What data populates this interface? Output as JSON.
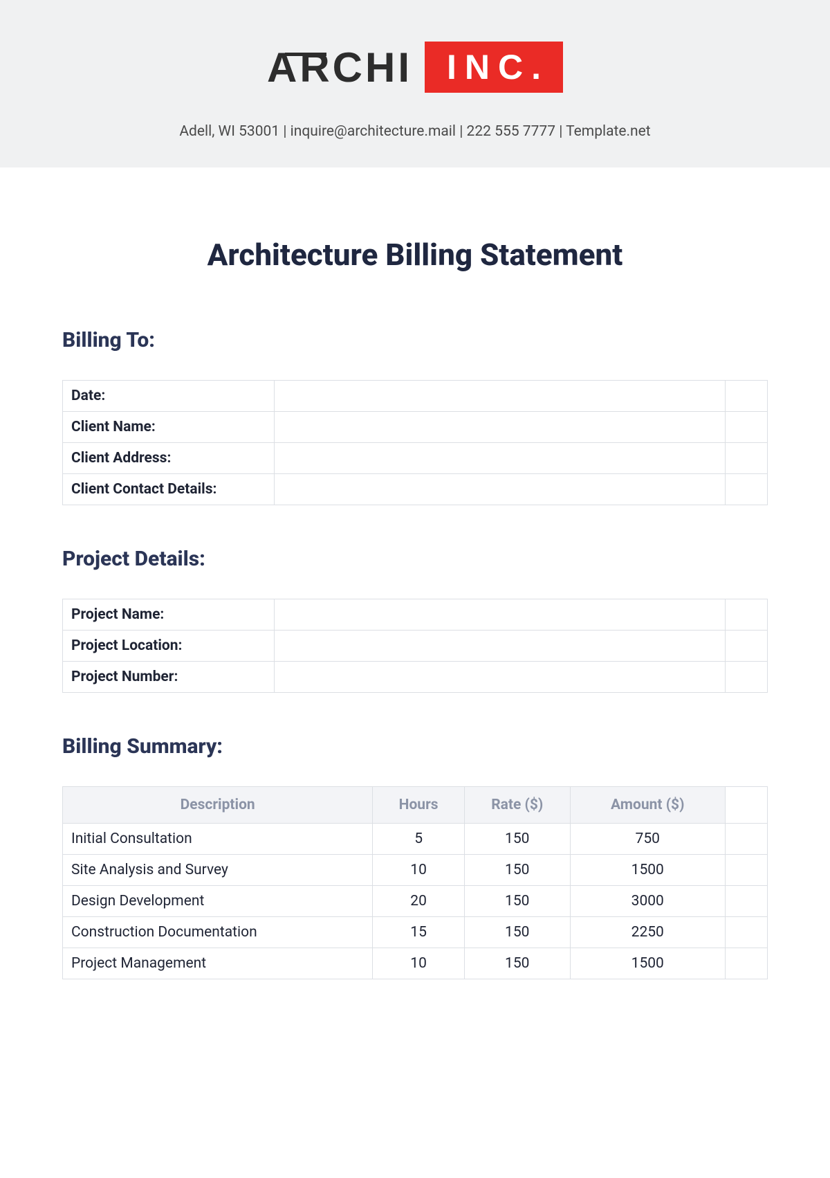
{
  "logo": {
    "word1": "ARCHI",
    "word2": "INC."
  },
  "contact_line": "Adell, WI 53001 | inquire@architecture.mail | 222 555 7777 | Template.net",
  "title": "Architecture Billing Statement",
  "billing_to": {
    "heading": "Billing To:",
    "rows": [
      {
        "label": "Date:",
        "value": ""
      },
      {
        "label": "Client Name:",
        "value": ""
      },
      {
        "label": "Client Address:",
        "value": ""
      },
      {
        "label": "Client Contact Details:",
        "value": ""
      }
    ]
  },
  "project_details": {
    "heading": "Project Details:",
    "rows": [
      {
        "label": "Project Name:",
        "value": ""
      },
      {
        "label": "Project Location:",
        "value": ""
      },
      {
        "label": "Project Number:",
        "value": ""
      }
    ]
  },
  "billing_summary": {
    "heading": "Billing Summary:",
    "columns": {
      "description": "Description",
      "hours": "Hours",
      "rate": "Rate ($)",
      "amount": "Amount ($)"
    },
    "rows": [
      {
        "description": "Initial Consultation",
        "hours": "5",
        "rate": "150",
        "amount": "750"
      },
      {
        "description": "Site Analysis and Survey",
        "hours": "10",
        "rate": "150",
        "amount": "1500"
      },
      {
        "description": "Design Development",
        "hours": "20",
        "rate": "150",
        "amount": "3000"
      },
      {
        "description": "Construction Documentation",
        "hours": "15",
        "rate": "150",
        "amount": "2250"
      },
      {
        "description": "Project Management",
        "hours": "10",
        "rate": "150",
        "amount": "1500"
      }
    ]
  }
}
